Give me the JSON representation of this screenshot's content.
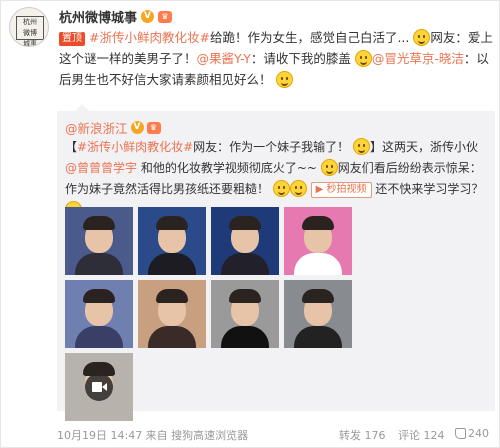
{
  "post": {
    "nick": "杭州微博城事",
    "avatar_seal": "杭州 微博 城事",
    "top_tag": "置顶",
    "topic": "#浙传小鲜肉教化妆#",
    "text_1": "给跪！作为女生，感觉自己白活了...",
    "text_2": "网友：爱上这个谜一样的美男子了",
    "mention_1": "@果酱Y-Y",
    "text_3": "：请收下我的膝盖",
    "mention_2": "@冒光草京-晓洁",
    "text_4": "：以后男生也不好信大家请素颜相见好么！"
  },
  "repost": {
    "nick": "@新浪浙江",
    "open_bracket": "【",
    "topic": "#浙传小鲜肉教化妆#",
    "text_1": "网友：作为一个妹子我输了！",
    "text_2": "】这两天，浙传小伙",
    "mention": "@曾曾曾学宇",
    "text_3": "和他的化妆教学视频彻底火了~~",
    "text_4": "网友们看后纷纷表示惊呆：作为妹子竟然活得比男孩纸还要粗糙！",
    "video_label": "秒拍视频",
    "text_5": "还不快来学习学习？",
    "photos": [
      {
        "name": "photo-1",
        "bg": "#4a5a8a",
        "shirt": "#2e2e38"
      },
      {
        "name": "photo-2",
        "bg": "#2a4a8a",
        "shirt": "#1c1c22"
      },
      {
        "name": "photo-3",
        "bg": "#1e3a78",
        "shirt": "#22202a"
      },
      {
        "name": "photo-4",
        "bg": "#e67ab0",
        "shirt": "#ffffff"
      },
      {
        "name": "photo-5",
        "bg": "#6f7fb0",
        "shirt": "#3a3f68"
      },
      {
        "name": "photo-6",
        "bg": "#c8a080",
        "shirt": "#3a2a28"
      },
      {
        "name": "photo-7",
        "bg": "#9a9a9a",
        "shirt": "#111111"
      },
      {
        "name": "photo-8",
        "bg": "#888c90",
        "shirt": "#222222"
      }
    ]
  },
  "footer": {
    "time": "10月19日 14:47 来自 搜狗高速浏览器",
    "repost_label": "转发 176",
    "comment_label": "评论 124",
    "like_count": "240"
  },
  "colors": {
    "link": "#eb7350",
    "top_tag": "#eb4d2a",
    "verified": "#f5a623"
  }
}
